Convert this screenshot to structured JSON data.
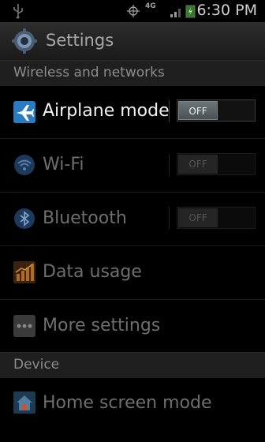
{
  "status_bar": {
    "time": "6:30 PM",
    "network": "4G",
    "icons": [
      "usb-icon",
      "gps-icon",
      "network-4g-icon",
      "signal-icon",
      "battery-charging-icon"
    ]
  },
  "header": {
    "title": "Settings",
    "icon": "gear-icon"
  },
  "sections": [
    {
      "label": "Wireless and networks",
      "items": [
        {
          "label": "Airplane mode",
          "icon": "airplane-icon",
          "toggle": "OFF",
          "enabled": true
        },
        {
          "label": "Wi-Fi",
          "icon": "wifi-icon",
          "toggle": "OFF",
          "enabled": false
        },
        {
          "label": "Bluetooth",
          "icon": "bluetooth-icon",
          "toggle": "OFF",
          "enabled": false
        },
        {
          "label": "Data usage",
          "icon": "data-usage-icon",
          "enabled": false
        },
        {
          "label": "More settings",
          "icon": "more-settings-icon",
          "enabled": false
        }
      ]
    },
    {
      "label": "Device",
      "items": [
        {
          "label": "Home screen mode",
          "icon": "home-screen-icon",
          "enabled": false
        }
      ]
    }
  ],
  "colors": {
    "background": "#000000",
    "header_bg": "#1f1f1f",
    "enabled_text": "#f2f2f2",
    "disabled_text": "#6e6e6e"
  }
}
